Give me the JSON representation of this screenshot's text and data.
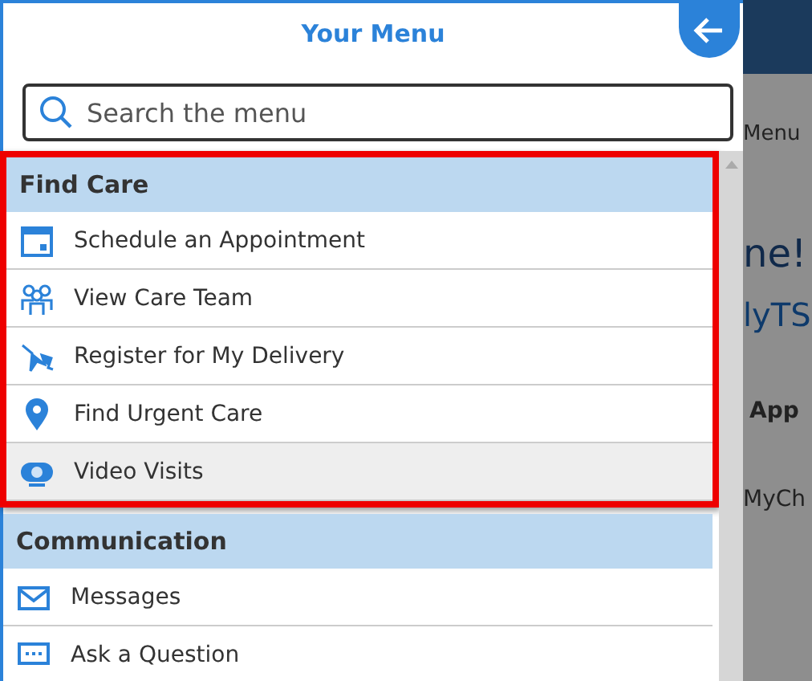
{
  "menu": {
    "title": "Your Menu",
    "search": {
      "placeholder": "Search the menu"
    },
    "sections": [
      {
        "title": "Find Care",
        "highlighted": true,
        "items": [
          {
            "label": "Schedule an Appointment",
            "kind": "calendar",
            "selected": false
          },
          {
            "label": "View Care Team",
            "kind": "team",
            "selected": false
          },
          {
            "label": "Register for My Delivery",
            "kind": "stork",
            "selected": false
          },
          {
            "label": "Find Urgent Care",
            "kind": "pin",
            "selected": false
          },
          {
            "label": "Video Visits",
            "kind": "camera",
            "selected": true
          }
        ]
      },
      {
        "title": "Communication",
        "highlighted": false,
        "items": [
          {
            "label": "Messages",
            "kind": "mail",
            "selected": false
          },
          {
            "label": "Ask a Question",
            "kind": "chat",
            "selected": false
          }
        ]
      }
    ]
  },
  "background": {
    "texts": [
      {
        "kind": "nav",
        "text": "Menu"
      },
      {
        "kind": "heading",
        "text": "ne!"
      },
      {
        "kind": "link",
        "text": "lyTS"
      },
      {
        "kind": "bold",
        "text": "App"
      },
      {
        "kind": "plain",
        "text": "MyCh"
      }
    ]
  }
}
